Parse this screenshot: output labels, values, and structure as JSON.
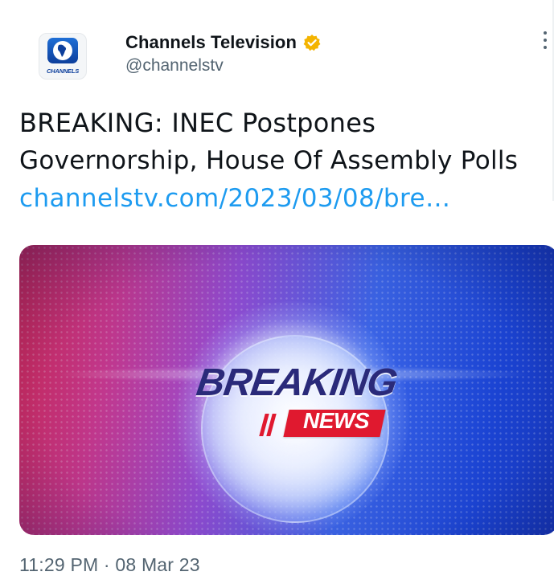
{
  "author": {
    "display_name": "Channels Television",
    "handle": "@channelstv",
    "verified_badge_color": "#f4b400",
    "avatar_brand": "CHANNELS"
  },
  "tweet": {
    "text_line_1": "BREAKING: INEC Postpones",
    "text_line_2": "Governorship, House Of Assembly Polls",
    "link_text": "channelstv.com/2023/03/08/bre…",
    "media": {
      "headline": "BREAKING",
      "subheadline": "NEWS"
    },
    "timestamp": "11:29 PM · 08 Mar 23"
  },
  "icons": {
    "more": "more-vertical-icon",
    "verified": "verified-badge-icon"
  },
  "colors": {
    "link": "#1d9bf0",
    "secondary_text": "#536471",
    "primary_text": "#0f1419"
  }
}
